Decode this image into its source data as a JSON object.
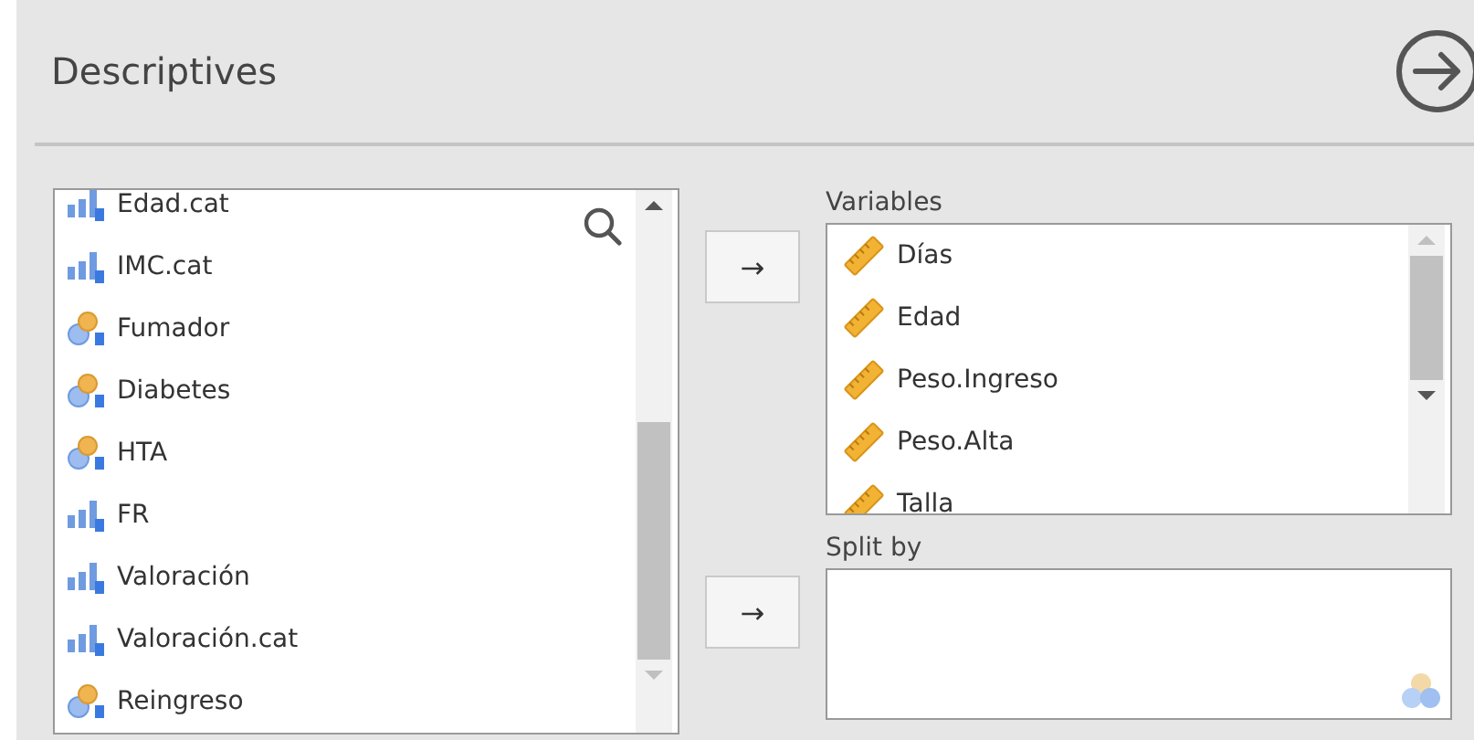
{
  "header": {
    "title": "Descriptives"
  },
  "source_list": {
    "items": [
      {
        "name": "Edad.cat",
        "kind": "ordinal"
      },
      {
        "name": "IMC.cat",
        "kind": "ordinal"
      },
      {
        "name": "Fumador",
        "kind": "nominal"
      },
      {
        "name": "Diabetes",
        "kind": "nominal"
      },
      {
        "name": "HTA",
        "kind": "nominal"
      },
      {
        "name": "FR",
        "kind": "ordinal"
      },
      {
        "name": "Valoración",
        "kind": "ordinal"
      },
      {
        "name": "Valoración.cat",
        "kind": "ordinal"
      },
      {
        "name": "Reingreso",
        "kind": "nominal"
      }
    ]
  },
  "targets": [
    {
      "label": "Variables",
      "button": "→",
      "items": [
        {
          "name": "Días",
          "kind": "continuous"
        },
        {
          "name": "Edad",
          "kind": "continuous"
        },
        {
          "name": "Peso.Ingreso",
          "kind": "continuous"
        },
        {
          "name": "Peso.Alta",
          "kind": "continuous"
        },
        {
          "name": "Talla",
          "kind": "continuous"
        }
      ]
    },
    {
      "label": "Split by",
      "button": "→"
    }
  ]
}
